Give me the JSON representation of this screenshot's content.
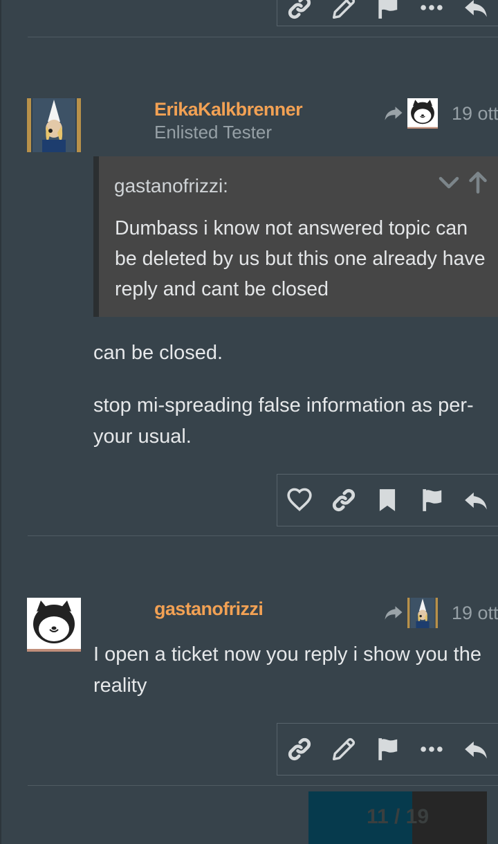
{
  "post_prev": {
    "actions": [
      {
        "icon": "link-icon"
      },
      {
        "icon": "pencil-icon"
      },
      {
        "icon": "flag-icon"
      },
      {
        "icon": "more-icon"
      },
      {
        "icon": "reply-icon"
      }
    ]
  },
  "post1": {
    "username": "ErikaKalkbrenner",
    "user_title": "Enlisted Tester",
    "date": "19 ott",
    "quote": {
      "author": "gastanofrizzi:",
      "text": "Dumbass i know not answered topic can be deleted by us but this one already have reply and cant be closed"
    },
    "paragraphs": [
      "can be closed.",
      "stop mi-spreading false information as per-your usual."
    ],
    "actions": [
      {
        "icon": "heart-icon"
      },
      {
        "icon": "link-icon"
      },
      {
        "icon": "bookmark-icon"
      },
      {
        "icon": "flag-icon"
      },
      {
        "icon": "reply-icon"
      }
    ]
  },
  "post2": {
    "username": "gastanofrizzi",
    "date": "19 ott",
    "text": "I open a ticket now you reply i show you the reality",
    "actions": [
      {
        "icon": "link-icon"
      },
      {
        "icon": "pencil-icon"
      },
      {
        "icon": "flag-icon"
      },
      {
        "icon": "more-icon"
      },
      {
        "icon": "reply-icon"
      }
    ]
  },
  "timeline": {
    "counter": "11 / 19",
    "progress": 0.58
  },
  "colors": {
    "background": "#37434b",
    "username": "#f2a154",
    "icon": "#d6dadc",
    "quote_bg": "#464646"
  }
}
